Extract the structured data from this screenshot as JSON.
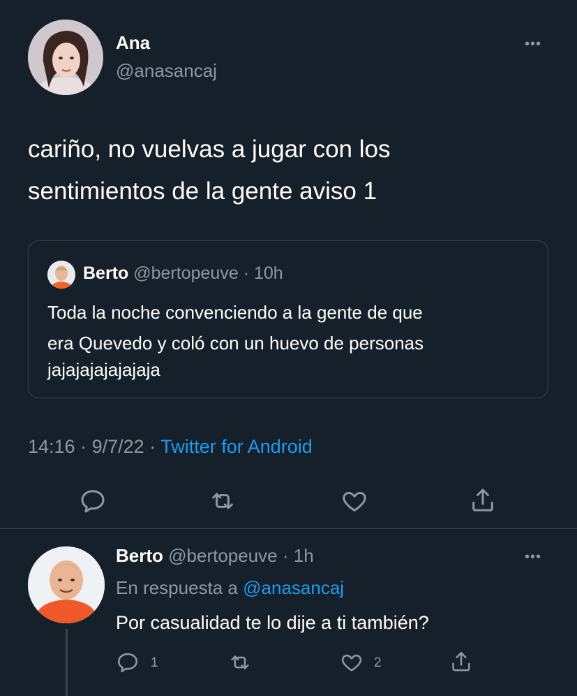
{
  "main_tweet": {
    "author_name": "Ana",
    "author_handle": "@anasancaj",
    "text_line1": "cariño, no vuelvas a jugar con los",
    "text_line2": "sentimientos de la gente aviso 1",
    "time": "14:16",
    "date": "9/7/22",
    "sep": "·",
    "source": "Twitter for Android",
    "more": "•••"
  },
  "quoted_tweet": {
    "author_name": "Berto",
    "author_handle": "@bertopeuve",
    "sep": "·",
    "time_ago": "10h",
    "text_line1": "Toda la noche convenciendo a la gente de que",
    "text_line2": "era Quevedo y coló con un huevo de personas",
    "text_line3": "jajajajajajajaja"
  },
  "reply": {
    "author_name": "Berto",
    "author_handle": "@bertopeuve",
    "sep": "·",
    "time_ago": "1h",
    "reply_prefix": "En respuesta a",
    "reply_to": "@anasancaj",
    "text": "Por casualidad te lo dije a ti también?",
    "reply_count": "1",
    "like_count": "2",
    "more": "•••"
  },
  "icons": {
    "main_actions": [
      "reply-icon",
      "retweet-icon",
      "like-icon",
      "share-icon"
    ],
    "reply_actions": [
      "reply-icon",
      "retweet-icon",
      "like-icon",
      "share-icon"
    ]
  },
  "colors": {
    "background": "#15202b",
    "text": "#ffffff",
    "muted": "#8b98a5",
    "link": "#1d9bf0",
    "border": "#38444d"
  }
}
